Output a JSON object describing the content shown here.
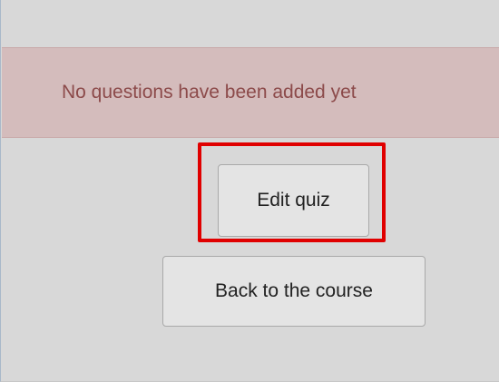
{
  "alert": {
    "message": "No questions have been added yet"
  },
  "actions": {
    "edit_quiz_label": "Edit quiz",
    "back_to_course_label": "Back to the course"
  },
  "colors": {
    "page_background": "#d8d8d8",
    "alert_background": "#d4bcbc",
    "alert_text": "#8c4a4a",
    "highlight_border": "#e00000",
    "button_background": "#e4e4e4"
  }
}
